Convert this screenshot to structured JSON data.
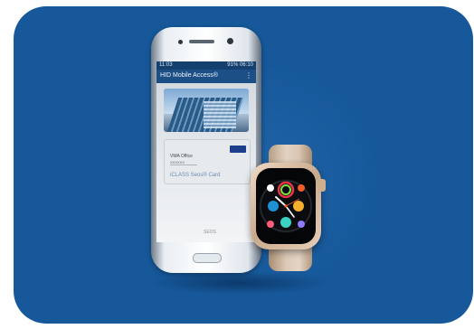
{
  "phone": {
    "status_left": "11:03",
    "status_right": "91% 06:10",
    "app_title": "HID Mobile Access®",
    "app_menu": "⋮",
    "building_caption": "",
    "credential_line1": "VMA Office",
    "credential_line2": "XXXXXX",
    "credential_type": "iCLASS Seos® Card",
    "seos_mark": "SEOS"
  },
  "watch": {
    "face": "infograph-complications"
  },
  "colors": {
    "panel": "#16589a",
    "background": "#ffffff",
    "watch_case": "#d8b89c",
    "watch_band": "#dcc9b6"
  }
}
